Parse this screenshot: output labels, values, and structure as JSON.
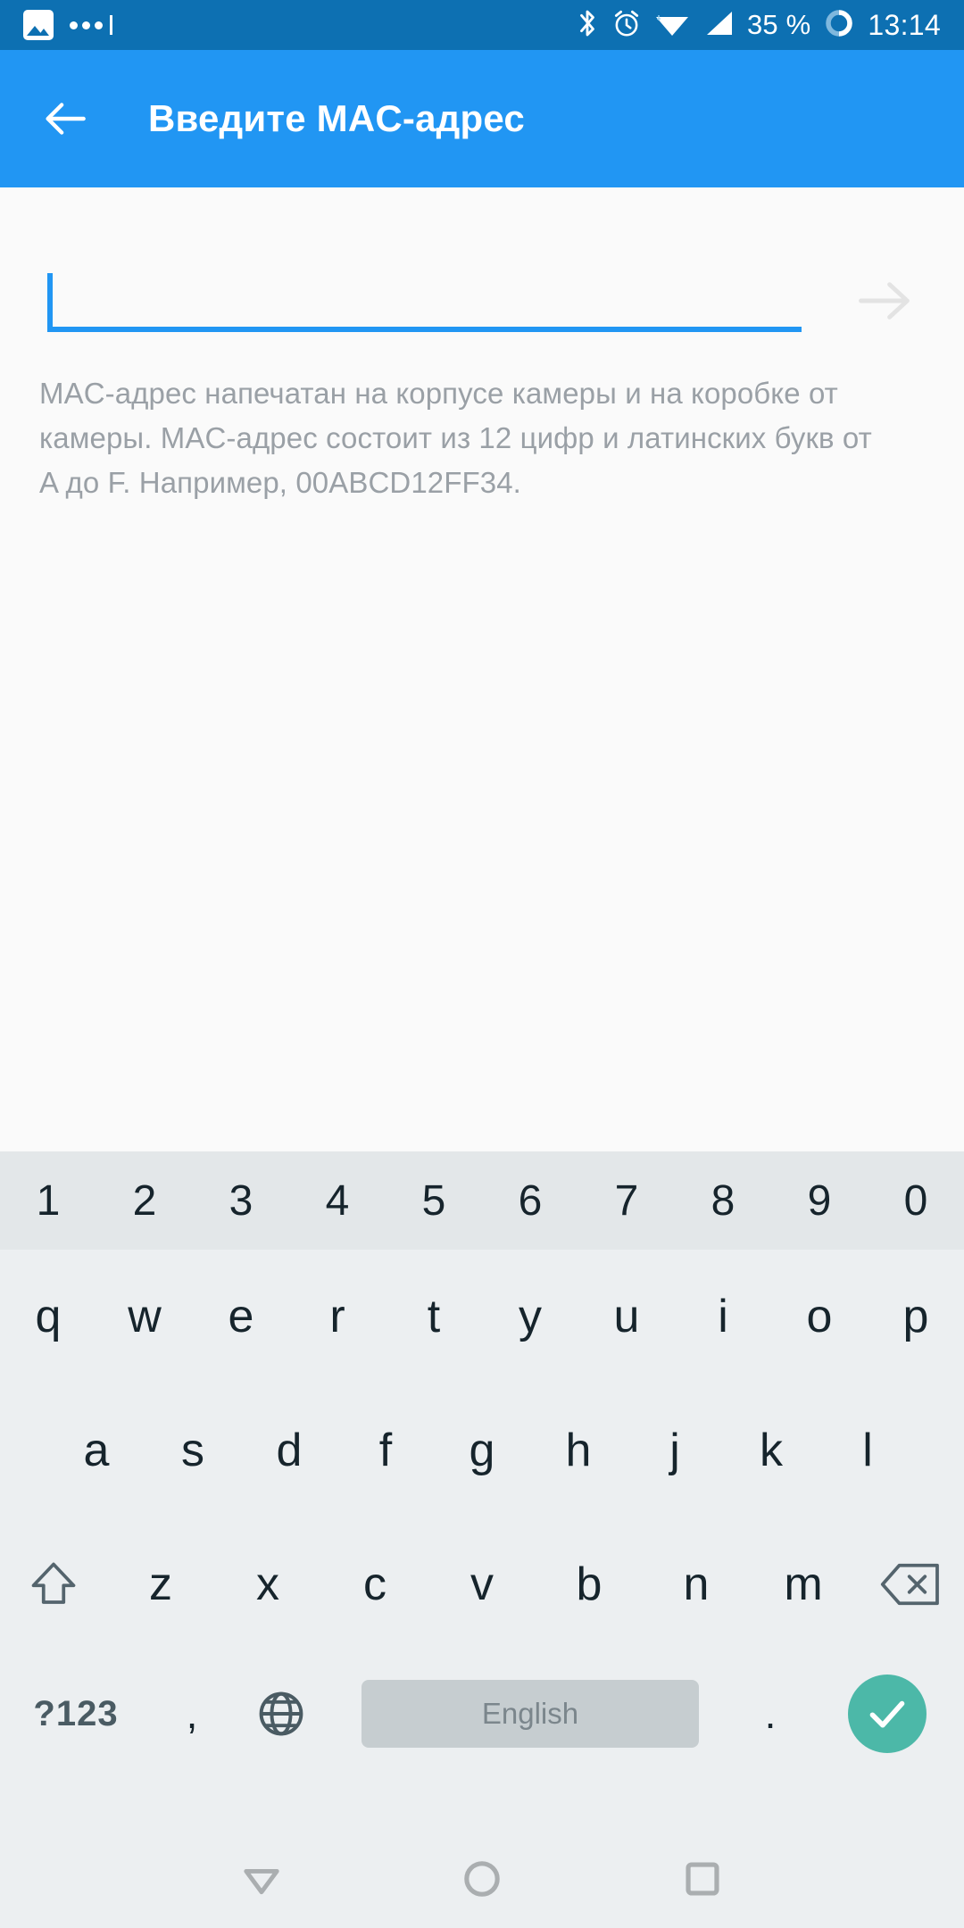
{
  "status_bar": {
    "background": "#0D70B2",
    "left_icons": [
      "image-notification-icon",
      "more-notifications-dots"
    ],
    "right_icons": [
      "bluetooth-icon",
      "alarm-icon",
      "wifi-icon",
      "cellular-signal-icon",
      "battery-ring-icon"
    ],
    "battery_percent": "35 %",
    "time": "13:14"
  },
  "toolbar": {
    "background": "#2196F3",
    "back_icon": "arrow-back-icon",
    "title": "Введите MAC-адрес"
  },
  "content": {
    "background": "#FAFAFA",
    "input": {
      "value": "",
      "placeholder": "",
      "underline_color": "#2196F3",
      "caret_visible": true
    },
    "submit_icon": "arrow-forward-icon",
    "hint": "MAC-адрес напечатан на корпусе камеры и на коробке от камеры. MAC-адрес состоит из 12 цифр и латинских букв от A до F. Например, 00ABCD12FF34."
  },
  "keyboard": {
    "background": "#ECEFF1",
    "number_row_background": "#E3E7E9",
    "rows": {
      "numbers": [
        "1",
        "2",
        "3",
        "4",
        "5",
        "6",
        "7",
        "8",
        "9",
        "0"
      ],
      "qwerty": [
        "q",
        "w",
        "e",
        "r",
        "t",
        "y",
        "u",
        "i",
        "o",
        "p"
      ],
      "asdf": [
        "a",
        "s",
        "d",
        "f",
        "g",
        "h",
        "j",
        "k",
        "l"
      ],
      "zxcv": [
        "z",
        "x",
        "c",
        "v",
        "b",
        "n",
        "m"
      ]
    },
    "shift_key": "shift-icon",
    "delete_key": "backspace-icon",
    "symbols_key": "?123",
    "comma_key": ",",
    "globe_key": "language-globe-icon",
    "spacebar_label": "English",
    "spacebar_color": "#C6CDD0",
    "period_key": ".",
    "enter_key": "check-icon",
    "enter_key_color": "#4CB8A8"
  },
  "nav_bar": {
    "background": "#ECEFF1",
    "buttons": [
      "back-down-triangle-icon",
      "home-circle-icon",
      "recents-square-icon"
    ]
  }
}
